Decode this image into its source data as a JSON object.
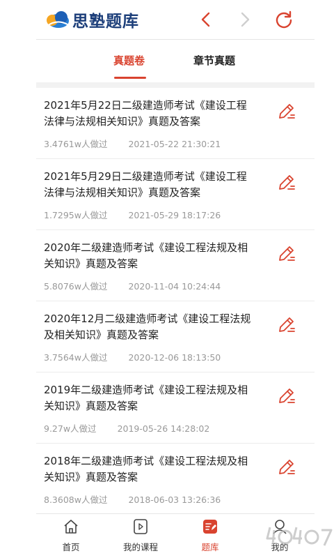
{
  "app": {
    "title": "思塾题库"
  },
  "header": {
    "back_icon": "chevron-left-icon",
    "forward_icon": "chevron-right-icon",
    "refresh_icon": "refresh-icon"
  },
  "tabs": [
    {
      "label": "真题卷",
      "active": true
    },
    {
      "label": "章节真题",
      "active": false
    }
  ],
  "items": [
    {
      "title": "2021年5月22日二级建造师考试《建设工程法律与法规相关知识》真题及答案",
      "count": "3.4761w人做过",
      "date": "2021-05-22 21:30:21"
    },
    {
      "title": "2021年5月29日二级建造师考试《建设工程法律与法规相关知识》真题及答案",
      "count": "1.7295w人做过",
      "date": "2021-05-29 18:17:26"
    },
    {
      "title": "2020年二级建造师考试《建设工程法规及相关知识》真题及答案",
      "count": "5.8076w人做过",
      "date": "2020-11-04 10:24:44"
    },
    {
      "title": "2020年12月二级建造师考试《建设工程法规及相关知识》真题及答案",
      "count": "3.7564w人做过",
      "date": "2020-12-06 18:13:50"
    },
    {
      "title": "2019年二级建造师考试《建设工程法规及相关知识》真题及答案",
      "count": "9.27w人做过",
      "date": "2019-05-26 14:28:02"
    },
    {
      "title": "2018年二级建造师考试《建设工程法规及相关知识》真题及答案",
      "count": "8.3608w人做过",
      "date": "2018-06-03 13:26:36"
    }
  ],
  "tabbar": [
    {
      "label": "首页",
      "icon": "home-icon"
    },
    {
      "label": "我的课程",
      "icon": "play-icon"
    },
    {
      "label": "题库",
      "icon": "question-bank-icon",
      "active": true
    },
    {
      "label": "我的",
      "icon": "profile-icon"
    }
  ],
  "colors": {
    "accent": "#d9432f",
    "brand_blue": "#1d3f7a",
    "muted": "#999999"
  }
}
